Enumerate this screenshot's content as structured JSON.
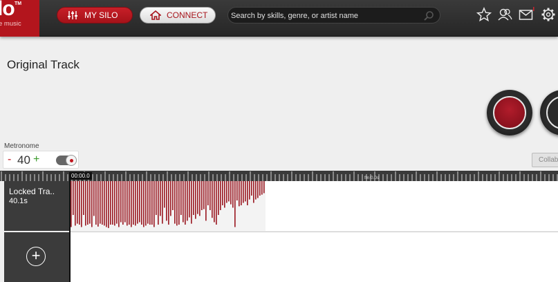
{
  "logo": {
    "text": "lo",
    "tm": "TM",
    "subtitle": "e music"
  },
  "nav": {
    "silo_label": "MY SILO",
    "connect_label": "CONNECT",
    "search_placeholder": "Search by skills, genre, or artist name"
  },
  "header_icons": [
    "star-icon",
    "people-icon",
    "mail-icon",
    "gear-icon"
  ],
  "page": {
    "title": "Original Track"
  },
  "metronome": {
    "label": "Metronome",
    "minus": "-",
    "value": "40",
    "plus": "+"
  },
  "collab_label": "Collab",
  "timeline": {
    "time": "00:00.0",
    "marker": "fm 0.0s"
  },
  "track": {
    "name": "Locked Track",
    "name_display": "Locked Tra..",
    "duration": "40.1s"
  },
  "add_track_symbol": "+",
  "colors": {
    "brand": "#b3151d",
    "waveform": "#9b1b24",
    "topbar": "#2f2f2f"
  },
  "waveform_levels": [
    0.95,
    0.7,
    0.92,
    0.88,
    0.9,
    0.95,
    0.7,
    0.92,
    0.9,
    0.88,
    0.95,
    0.72,
    0.9,
    0.94,
    0.88,
    0.9,
    0.92,
    0.95,
    0.97,
    0.9,
    0.9,
    0.92,
    0.88,
    0.95,
    0.85,
    0.9,
    0.85,
    0.92,
    0.9,
    0.95,
    0.9,
    0.92,
    0.88,
    0.85,
    0.9,
    0.95,
    0.92,
    0.88,
    0.9,
    0.9,
    0.95,
    0.7,
    0.9,
    0.72,
    0.88,
    0.55,
    0.82,
    0.9,
    0.72,
    0.6,
    0.88,
    0.92,
    0.9,
    0.7,
    0.85,
    0.9,
    0.82,
    0.75,
    0.88,
    0.7,
    0.78,
    0.68,
    0.72,
    0.6,
    0.58,
    0.82,
    0.5,
    0.6,
    0.76,
    0.85,
    0.9,
    0.7,
    0.6,
    0.5,
    0.55,
    0.45,
    0.42,
    0.48,
    0.55,
    0.95,
    0.4,
    0.52,
    0.5,
    0.45,
    0.42,
    0.5,
    0.38,
    0.3,
    0.45,
    0.38,
    0.35,
    0.3,
    0.28,
    0.25
  ]
}
